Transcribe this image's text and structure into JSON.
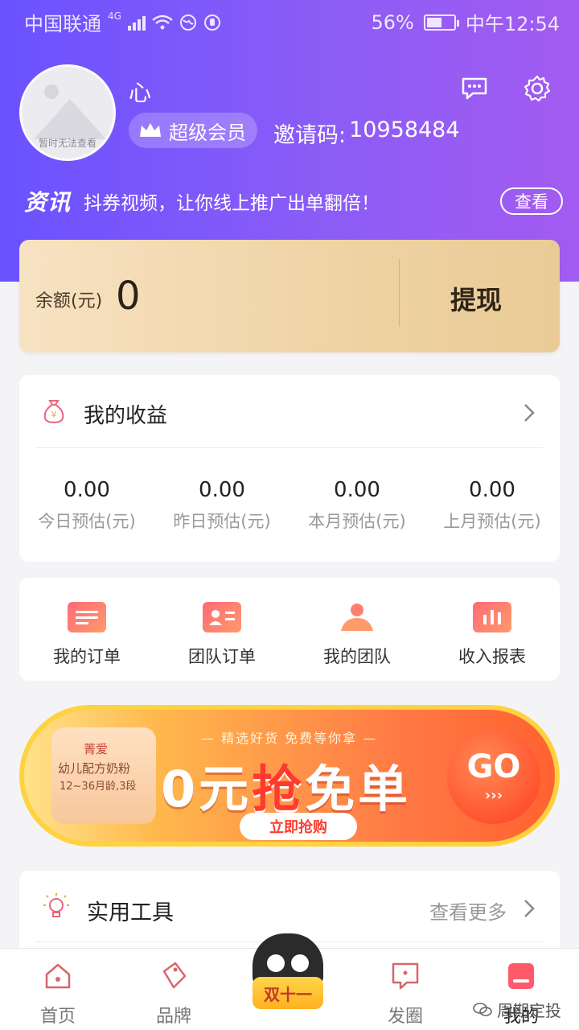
{
  "status_bar": {
    "carrier": "中国联通",
    "network": "4G",
    "battery": "56%",
    "time": "中午12:54",
    "battery_level": 0.56
  },
  "profile": {
    "avatar_caption": "暂时无法查看",
    "nickname": "心",
    "vip_label": "超级会员",
    "invite_label": "邀请码:",
    "invite_code": "10958484"
  },
  "news": {
    "tag": "资讯",
    "message": "抖券视频，让你线上推广出单翻倍！",
    "button": "查看"
  },
  "balance": {
    "label": "余额(元)",
    "value": "0",
    "withdraw_label": "提现"
  },
  "earnings": {
    "title": "我的收益",
    "stats": [
      {
        "value": "0.00",
        "label": "今日预估(元)"
      },
      {
        "value": "0.00",
        "label": "昨日预估(元)"
      },
      {
        "value": "0.00",
        "label": "本月预估(元)"
      },
      {
        "value": "0.00",
        "label": "上月预估(元)"
      }
    ]
  },
  "shortcuts": [
    {
      "label": "我的订单",
      "icon": "order-list-icon"
    },
    {
      "label": "团队订单",
      "icon": "team-order-icon"
    },
    {
      "label": "我的团队",
      "icon": "team-icon"
    },
    {
      "label": "收入报表",
      "icon": "report-chart-icon"
    }
  ],
  "banner": {
    "strip_text": "— 精选好货 免费等你拿 —",
    "headline_a": "0元",
    "headline_b": "抢",
    "headline_c": "免单",
    "button": "立即抢购",
    "go": "GO",
    "arrows": "›››",
    "product_line1": "菁爱",
    "product_line2": "幼儿配方奶粉",
    "product_line3": "12~36月龄,3段"
  },
  "tools": {
    "title": "实用工具",
    "more": "查看更多"
  },
  "tabbar": {
    "items": [
      {
        "label": "首页",
        "icon": "home-icon"
      },
      {
        "label": "品牌",
        "icon": "tag-icon"
      },
      {
        "label": "发圈",
        "icon": "chat-bubble-icon"
      },
      {
        "label": "我的",
        "icon": "profile-icon"
      }
    ],
    "promo_label": "双十一"
  },
  "watermark": "周期定投",
  "colors": {
    "header_start": "#6a52ff",
    "header_end": "#a35bf0",
    "accent": "#ff5a5f",
    "gold": "#efd3a4"
  }
}
